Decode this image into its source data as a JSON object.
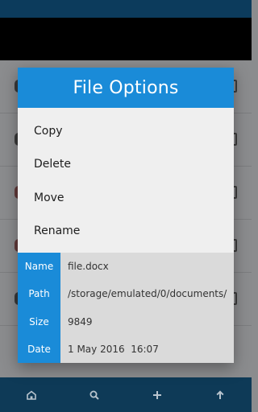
{
  "dialog": {
    "title": "File Options",
    "options": [
      "Copy",
      "Delete",
      "Move",
      "Rename"
    ]
  },
  "details": {
    "name_label": "Name",
    "name_value": "file.docx",
    "path_label": "Path",
    "path_value": "/storage/emulated/0/documents/",
    "size_label": "Size",
    "size_value": "9849",
    "date_label": "Date",
    "date_value": "1 May 2016  16:07"
  },
  "bottom_nav": {
    "icons": [
      "home-icon",
      "search-icon",
      "add-icon",
      "up-arrow-icon"
    ]
  },
  "colors": {
    "accent": "#1a8bd8",
    "top_bar": "#0c3b5c",
    "bottom_bar": "#0e3a57",
    "dim_background": "#8b8c8e",
    "dialog_bg": "#efefef",
    "details_values_bg": "#dadada"
  }
}
